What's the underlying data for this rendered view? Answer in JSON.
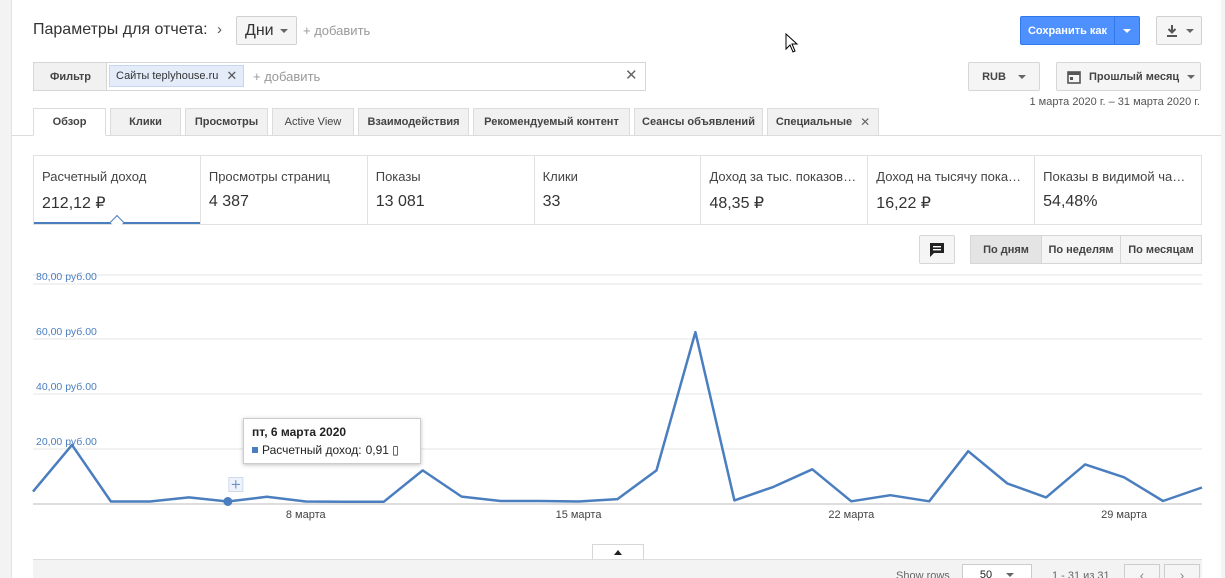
{
  "header": {
    "params_label": "Параметры для отчета:",
    "granularity": "Дни",
    "add_label": "+ добавить",
    "save_label": "Сохранить как"
  },
  "filter": {
    "button_label": "Фильтр",
    "chip_prefix": "Сайты",
    "chip_value": "teplyhouse.ru",
    "add_placeholder": "+ добавить",
    "currency": "RUB",
    "period": "Прошлый месяц",
    "date_range": "1 марта 2020 г. – 31 марта 2020 г."
  },
  "tabs": [
    {
      "label": "Обзор"
    },
    {
      "label": "Клики"
    },
    {
      "label": "Просмотры"
    },
    {
      "label": "Active View"
    },
    {
      "label": "Взаимодействия"
    },
    {
      "label": "Рекомендуемый контент"
    },
    {
      "label": "Сеансы объявлений"
    },
    {
      "label": "Специальные"
    }
  ],
  "metrics": [
    {
      "label": "Расчетный доход",
      "value": "212,12 ₽"
    },
    {
      "label": "Просмотры страниц",
      "value": "4 387"
    },
    {
      "label": "Показы",
      "value": "13 081"
    },
    {
      "label": "Клики",
      "value": "33"
    },
    {
      "label": "Доход за тыс. показов…",
      "value": "48,35 ₽"
    },
    {
      "label": "Доход на тысячу пока…",
      "value": "16,22 ₽"
    },
    {
      "label": "Показы в видимой ча…",
      "value": "54,48%"
    }
  ],
  "view_toggle": {
    "days": "По дням",
    "weeks": "По неделям",
    "months": "По месяцам"
  },
  "tooltip": {
    "title": "пт, 6 марта 2020",
    "label": "Расчетный доход:",
    "value": "0,91 ▯"
  },
  "chart_data": {
    "type": "line",
    "series": [
      {
        "name": "Расчетный доход",
        "x": [
          1,
          2,
          3,
          4,
          5,
          6,
          7,
          8,
          9,
          10,
          11,
          12,
          13,
          14,
          15,
          16,
          17,
          18,
          19,
          20,
          21,
          22,
          23,
          24,
          25,
          26,
          27,
          28,
          29,
          30,
          31
        ],
        "values": [
          4.5,
          21.5,
          0.9,
          0.9,
          2.4,
          0.91,
          2.6,
          0.9,
          0.8,
          0.8,
          12.2,
          2.7,
          1.1,
          1.1,
          0.9,
          1.8,
          12.2,
          62.5,
          1.3,
          6.2,
          12.6,
          1.0,
          3.2,
          1.0,
          19.2,
          7.5,
          2.4,
          14.4,
          9.7,
          1.1,
          6.0
        ]
      }
    ],
    "yticks": [
      "80,00 руб.00",
      "60,00 руб.00",
      "40,00 руб.00",
      "20,00 руб.00"
    ],
    "ytick_values": [
      80,
      60,
      40,
      20
    ],
    "ylim": [
      0,
      80
    ],
    "xticks": [
      "8 марта",
      "15 марта",
      "22 марта",
      "29 марта"
    ],
    "xtick_values": [
      8,
      15,
      22,
      29
    ],
    "xlim": [
      1,
      31
    ],
    "grid": true,
    "color": "#4a7ebf",
    "highlight_x": 6
  },
  "footer": {
    "show_rows_label": "Show rows",
    "rows_value": "50",
    "pager_text": "1 - 31 из 31"
  },
  "colors": {
    "accent": "#4d90fe",
    "series": "#4a7ebf"
  }
}
